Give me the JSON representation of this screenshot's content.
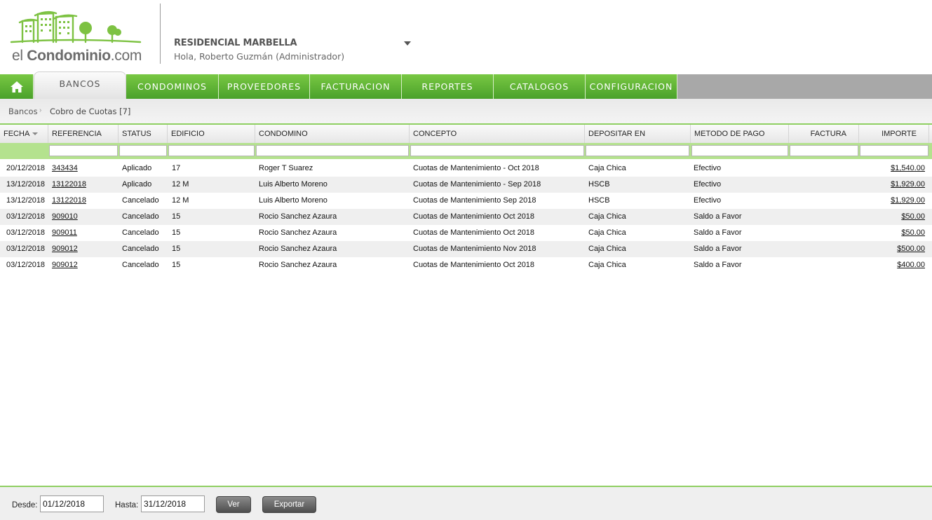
{
  "brand": {
    "logo_text_light": "el ",
    "logo_text_bold": "Condominio",
    "logo_text_suffix": ".com",
    "green": "#5bb030"
  },
  "site": {
    "name": "RESIDENCIAL MARBELLA",
    "greeting": "Hola, Roberto Guzmán (Administrador)"
  },
  "nav": {
    "home_icon": "home-icon",
    "active": "BANCOS",
    "items": [
      "CONDOMINOS",
      "PROVEEDORES",
      "FACTURACION",
      "REPORTES",
      "CATALOGOS",
      "CONFIGURACION"
    ]
  },
  "breadcrumb": {
    "root": "Bancos",
    "current": "Cobro de Cuotas [7]"
  },
  "table": {
    "columns": [
      "FECHA",
      "REFERENCIA",
      "STATUS",
      "EDIFICIO",
      "CONDOMINO",
      "CONCEPTO",
      "DEPOSITAR EN",
      "METODO DE PAGO",
      "FACTURA",
      "IMPORTE"
    ],
    "rows": [
      {
        "fecha": "20/12/2018",
        "referencia": "343434",
        "status": "Aplicado",
        "edificio": "17",
        "condomino": "Roger T Suarez",
        "concepto": "Cuotas de Mantenimiento - Oct 2018",
        "depositar": "Caja Chica",
        "metodo": "Efectivo",
        "factura": "",
        "importe": "$1,540.00"
      },
      {
        "fecha": "13/12/2018",
        "referencia": "13122018",
        "status": "Aplicado",
        "edificio": "12 M",
        "condomino": "Luis Alberto Moreno",
        "concepto": "Cuotas de Mantenimiento - Sep 2018",
        "depositar": "HSCB",
        "metodo": "Efectivo",
        "factura": "",
        "importe": "$1,929.00"
      },
      {
        "fecha": "13/12/2018",
        "referencia": "13122018",
        "status": "Cancelado",
        "edificio": "12 M",
        "condomino": "Luis Alberto Moreno",
        "concepto": "Cuotas de Mantenimiento Sep 2018",
        "depositar": "HSCB",
        "metodo": "Efectivo",
        "factura": "",
        "importe": "$1,929.00"
      },
      {
        "fecha": "03/12/2018",
        "referencia": "909010",
        "status": "Cancelado",
        "edificio": "15",
        "condomino": "Rocio Sanchez Azaura",
        "concepto": "Cuotas de Mantenimiento Oct 2018",
        "depositar": "Caja Chica",
        "metodo": "Saldo a Favor",
        "factura": "",
        "importe": "$50.00"
      },
      {
        "fecha": "03/12/2018",
        "referencia": "909011",
        "status": "Cancelado",
        "edificio": "15",
        "condomino": "Rocio Sanchez Azaura",
        "concepto": "Cuotas de Mantenimiento Oct 2018",
        "depositar": "Caja Chica",
        "metodo": "Saldo a Favor",
        "factura": "",
        "importe": "$50.00"
      },
      {
        "fecha": "03/12/2018",
        "referencia": "909012",
        "status": "Cancelado",
        "edificio": "15",
        "condomino": "Rocio Sanchez Azaura",
        "concepto": "Cuotas de Mantenimiento Nov 2018",
        "depositar": "Caja Chica",
        "metodo": "Saldo a Favor",
        "factura": "",
        "importe": "$500.00"
      },
      {
        "fecha": "03/12/2018",
        "referencia": "909012",
        "status": "Cancelado",
        "edificio": "15",
        "condomino": "Rocio Sanchez Azaura",
        "concepto": "Cuotas de Mantenimiento Oct 2018",
        "depositar": "Caja Chica",
        "metodo": "Saldo a Favor",
        "factura": "",
        "importe": "$400.00"
      }
    ]
  },
  "footer": {
    "desde_label": "Desde:",
    "desde_value": "01/12/2018",
    "hasta_label": "Hasta:",
    "hasta_value": "31/12/2018",
    "ver_label": "Ver",
    "exportar_label": "Exportar"
  }
}
